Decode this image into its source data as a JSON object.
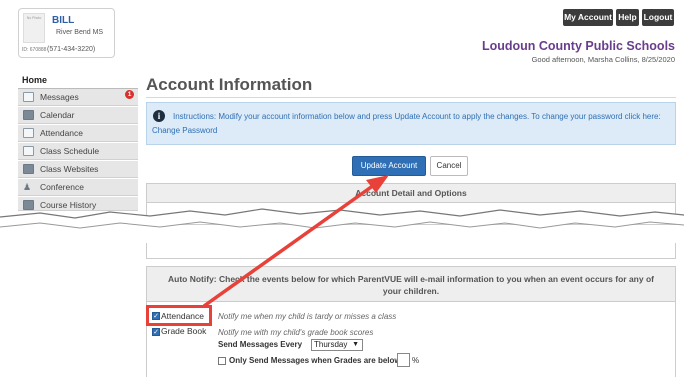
{
  "student": {
    "name": "BILL",
    "photo_caption": "No Photo",
    "school": "River Bend MS",
    "id_label": "ID: 670888",
    "phone": "(571-434-3220)"
  },
  "header": {
    "my_account": "My Account",
    "help": "Help",
    "logout": "Logout",
    "district": "Loudoun County Public Schools",
    "greeting": "Good afternoon, Marsha Collins, 8/25/2020"
  },
  "sidebar": {
    "home": "Home",
    "badge": "1",
    "items": [
      {
        "label": "Messages",
        "icon": "envelope-icon"
      },
      {
        "label": "Calendar",
        "icon": "calendar-icon"
      },
      {
        "label": "Attendance",
        "icon": "attendance-icon"
      },
      {
        "label": "Class Schedule",
        "icon": "schedule-icon"
      },
      {
        "label": "Class Websites",
        "icon": "website-icon"
      },
      {
        "label": "Conference",
        "icon": "conference-icon"
      },
      {
        "label": "Course History",
        "icon": "history-icon"
      }
    ]
  },
  "main": {
    "title": "Account Information",
    "instructions": "Instructions: Modify your account information below and press Update Account to apply the changes. To change your password click here:",
    "change_password": "Change Password",
    "update_button": "Update Account",
    "cancel_button": "Cancel",
    "detail_header": "Account Detail and Options",
    "auto_notify_line1": "Auto Notify: Check the events below for which ParentVUE will e-mail information to you when an event occurs for any of",
    "auto_notify_line2": "your children.",
    "attendance_label": "Attendance",
    "attendance_desc": "Notify me when my child is tardy or misses a class",
    "gradebook_label": "Grade Book",
    "gradebook_desc": "Notify me with my child's grade book scores",
    "send_every_label": "Send Messages Every",
    "send_every_value": "Thursday",
    "only_when_label": "Only Send Messages when Grades are below:",
    "percent": "%"
  },
  "colors": {
    "accent": "#2f6fb5",
    "annotation": "#e8413a",
    "district": "#6a3d8c"
  }
}
